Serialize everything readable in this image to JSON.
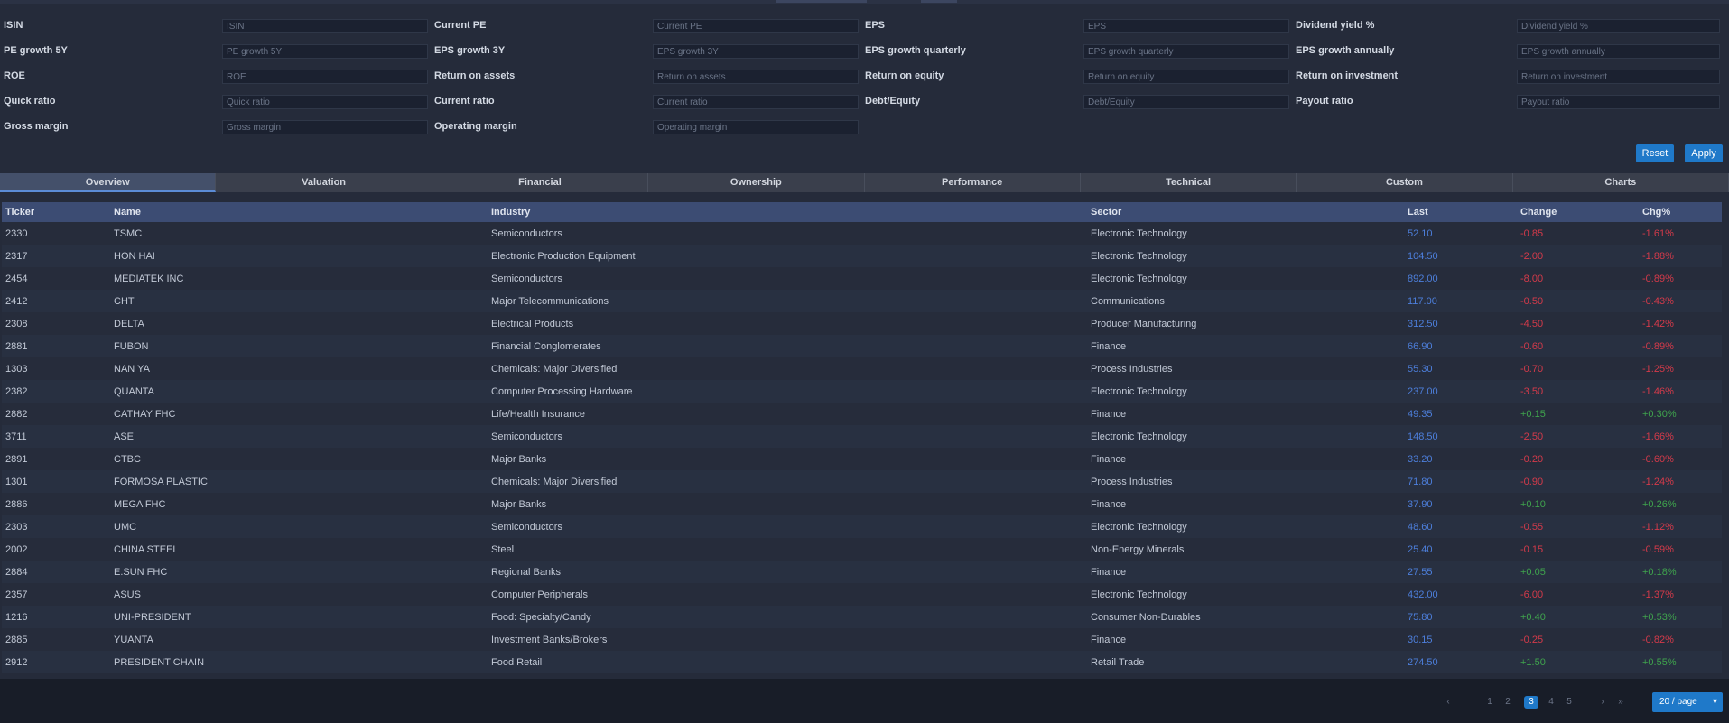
{
  "filters": {
    "rows": [
      [
        {
          "label": "ISIN",
          "placeholder": "ISIN"
        },
        {
          "label": "Current PE",
          "placeholder": "Current PE"
        },
        {
          "label": "EPS",
          "placeholder": "EPS"
        },
        {
          "label": "Dividend yield %",
          "placeholder": "Dividend yield %"
        }
      ],
      [
        {
          "label": "PE growth 5Y",
          "placeholder": "PE growth 5Y"
        },
        {
          "label": "EPS growth 3Y",
          "placeholder": "EPS growth 3Y"
        },
        {
          "label": "EPS growth quarterly",
          "placeholder": "EPS growth quarterly"
        },
        {
          "label": "EPS growth annually",
          "placeholder": "EPS growth annually"
        }
      ],
      [
        {
          "label": "ROE",
          "placeholder": "ROE"
        },
        {
          "label": "Return on assets",
          "placeholder": "Return on assets"
        },
        {
          "label": "Return on equity",
          "placeholder": "Return on equity"
        },
        {
          "label": "Return on investment",
          "placeholder": "Return on investment"
        }
      ],
      [
        {
          "label": "Quick ratio",
          "placeholder": "Quick ratio"
        },
        {
          "label": "Current ratio",
          "placeholder": "Current ratio"
        },
        {
          "label": "Debt/Equity",
          "placeholder": "Debt/Equity"
        },
        {
          "label": "Payout ratio",
          "placeholder": "Payout ratio"
        }
      ],
      [
        {
          "label": "Gross margin",
          "placeholder": "Gross margin"
        },
        {
          "label": "Operating margin",
          "placeholder": "Operating margin"
        }
      ]
    ],
    "reset_label": "Reset",
    "apply_label": "Apply"
  },
  "tabs": [
    "Overview",
    "Valuation",
    "Financial",
    "Ownership",
    "Performance",
    "Technical",
    "Custom",
    "Charts"
  ],
  "table": {
    "columns": [
      "Ticker",
      "Name",
      "Industry",
      "Sector",
      "Last",
      "Change",
      "Chg%"
    ],
    "rows": [
      {
        "ticker": "2330",
        "name": "TSMC",
        "industry": "Semiconductors",
        "sector": "Electronic Technology",
        "last": "52.10",
        "chg": "-0.85",
        "pct": "-1.61%",
        "cls": "neg"
      },
      {
        "ticker": "2317",
        "name": "HON HAI",
        "industry": "Electronic Production Equipment",
        "sector": "Electronic Technology",
        "last": "104.50",
        "chg": "-2.00",
        "pct": "-1.88%",
        "cls": "neg"
      },
      {
        "ticker": "2454",
        "name": "MEDIATEK INC",
        "industry": "Semiconductors",
        "sector": "Electronic Technology",
        "last": "892.00",
        "chg": "-8.00",
        "pct": "-0.89%",
        "cls": "neg"
      },
      {
        "ticker": "2412",
        "name": "CHT",
        "industry": "Major Telecommunications",
        "sector": "Communications",
        "last": "117.00",
        "chg": "-0.50",
        "pct": "-0.43%",
        "cls": "neg"
      },
      {
        "ticker": "2308",
        "name": "DELTA",
        "industry": "Electrical Products",
        "sector": "Producer Manufacturing",
        "last": "312.50",
        "chg": "-4.50",
        "pct": "-1.42%",
        "cls": "neg"
      },
      {
        "ticker": "2881",
        "name": "FUBON",
        "industry": "Financial Conglomerates",
        "sector": "Finance",
        "last": "66.90",
        "chg": "-0.60",
        "pct": "-0.89%",
        "cls": "neg"
      },
      {
        "ticker": "1303",
        "name": "NAN YA",
        "industry": "Chemicals: Major Diversified",
        "sector": "Process Industries",
        "last": "55.30",
        "chg": "-0.70",
        "pct": "-1.25%",
        "cls": "neg"
      },
      {
        "ticker": "2382",
        "name": "QUANTA",
        "industry": "Computer Processing Hardware",
        "sector": "Electronic Technology",
        "last": "237.00",
        "chg": "-3.50",
        "pct": "-1.46%",
        "cls": "neg"
      },
      {
        "ticker": "2882",
        "name": "CATHAY FHC",
        "industry": "Life/Health Insurance",
        "sector": "Finance",
        "last": "49.35",
        "chg": "+0.15",
        "pct": "+0.30%",
        "cls": "pos"
      },
      {
        "ticker": "3711",
        "name": "ASE",
        "industry": "Semiconductors",
        "sector": "Electronic Technology",
        "last": "148.50",
        "chg": "-2.50",
        "pct": "-1.66%",
        "cls": "neg"
      },
      {
        "ticker": "2891",
        "name": "CTBC",
        "industry": "Major Banks",
        "sector": "Finance",
        "last": "33.20",
        "chg": "-0.20",
        "pct": "-0.60%",
        "cls": "neg"
      },
      {
        "ticker": "1301",
        "name": "FORMOSA PLASTIC",
        "industry": "Chemicals: Major Diversified",
        "sector": "Process Industries",
        "last": "71.80",
        "chg": "-0.90",
        "pct": "-1.24%",
        "cls": "neg"
      },
      {
        "ticker": "2886",
        "name": "MEGA FHC",
        "industry": "Major Banks",
        "sector": "Finance",
        "last": "37.90",
        "chg": "+0.10",
        "pct": "+0.26%",
        "cls": "pos"
      },
      {
        "ticker": "2303",
        "name": "UMC",
        "industry": "Semiconductors",
        "sector": "Electronic Technology",
        "last": "48.60",
        "chg": "-0.55",
        "pct": "-1.12%",
        "cls": "neg"
      },
      {
        "ticker": "2002",
        "name": "CHINA STEEL",
        "industry": "Steel",
        "sector": "Non-Energy Minerals",
        "last": "25.40",
        "chg": "-0.15",
        "pct": "-0.59%",
        "cls": "neg"
      },
      {
        "ticker": "2884",
        "name": "E.SUN FHC",
        "industry": "Regional Banks",
        "sector": "Finance",
        "last": "27.55",
        "chg": "+0.05",
        "pct": "+0.18%",
        "cls": "pos"
      },
      {
        "ticker": "2357",
        "name": "ASUS",
        "industry": "Computer Peripherals",
        "sector": "Electronic Technology",
        "last": "432.00",
        "chg": "-6.00",
        "pct": "-1.37%",
        "cls": "neg"
      },
      {
        "ticker": "1216",
        "name": "UNI-PRESIDENT",
        "industry": "Food: Specialty/Candy",
        "sector": "Consumer Non-Durables",
        "last": "75.80",
        "chg": "+0.40",
        "pct": "+0.53%",
        "cls": "pos"
      },
      {
        "ticker": "2885",
        "name": "YUANTA",
        "industry": "Investment Banks/Brokers",
        "sector": "Finance",
        "last": "30.15",
        "chg": "-0.25",
        "pct": "-0.82%",
        "cls": "neg"
      },
      {
        "ticker": "2912",
        "name": "PRESIDENT CHAIN",
        "industry": "Food Retail",
        "sector": "Retail Trade",
        "last": "274.50",
        "chg": "+1.50",
        "pct": "+0.55%",
        "cls": "pos"
      }
    ]
  },
  "pagination": {
    "prev": "‹",
    "pages": [
      "1",
      "2",
      "3",
      "4",
      "5"
    ],
    "current_index": 2,
    "next": "›",
    "last": "»",
    "page_size": "20 / page"
  }
}
